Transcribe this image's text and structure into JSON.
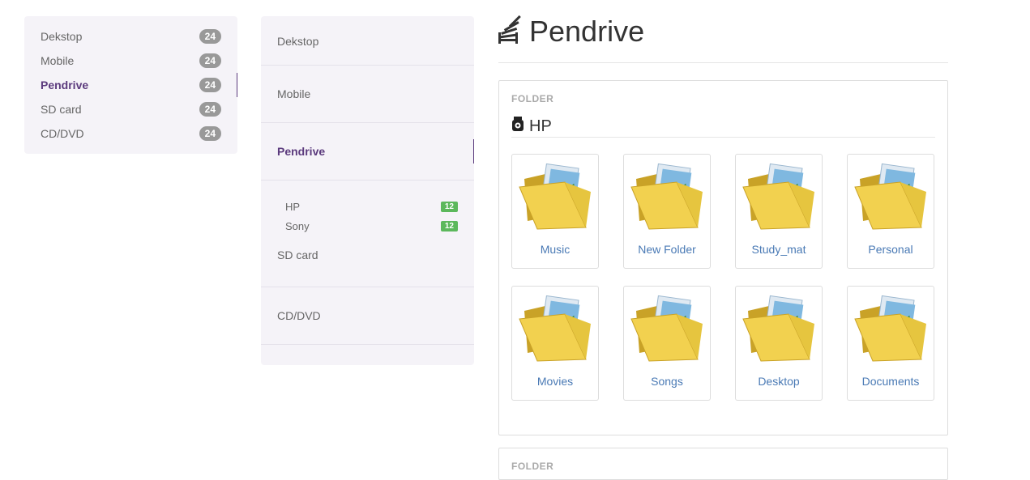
{
  "nav_primary": [
    {
      "label": "Dekstop",
      "count": "24"
    },
    {
      "label": "Mobile",
      "count": "24"
    },
    {
      "label": "Pendrive",
      "count": "24"
    },
    {
      "label": "SD card",
      "count": "24"
    },
    {
      "label": "CD/DVD",
      "count": "24"
    }
  ],
  "nav_primary_active": "Pendrive",
  "nav_secondary": {
    "items": [
      "Dekstop",
      "Mobile",
      "Pendrive",
      "SD card",
      "CD/DVD"
    ],
    "active": "Pendrive",
    "subitems": [
      {
        "label": "HP",
        "count": "12"
      },
      {
        "label": "Sony",
        "count": "12"
      }
    ]
  },
  "main": {
    "title": "Pendrive",
    "section_label": "FOLDER",
    "device_name": "HP",
    "folders": [
      "Music",
      "New Folder",
      "Study_mat",
      "Personal",
      "Movies",
      "Songs",
      "Desktop",
      "Documents"
    ],
    "next_section_label": "FOLDER"
  },
  "colors": {
    "accent": "#5b3a7d",
    "link": "#4a7ab5",
    "badge_gray": "#999999",
    "badge_green": "#5cb85c",
    "panel_bg": "#f5f3f8"
  },
  "icons": {
    "title_icon": "stack-icon",
    "device_icon": "usb-drive-icon",
    "folder_icon": "folder-icon"
  }
}
